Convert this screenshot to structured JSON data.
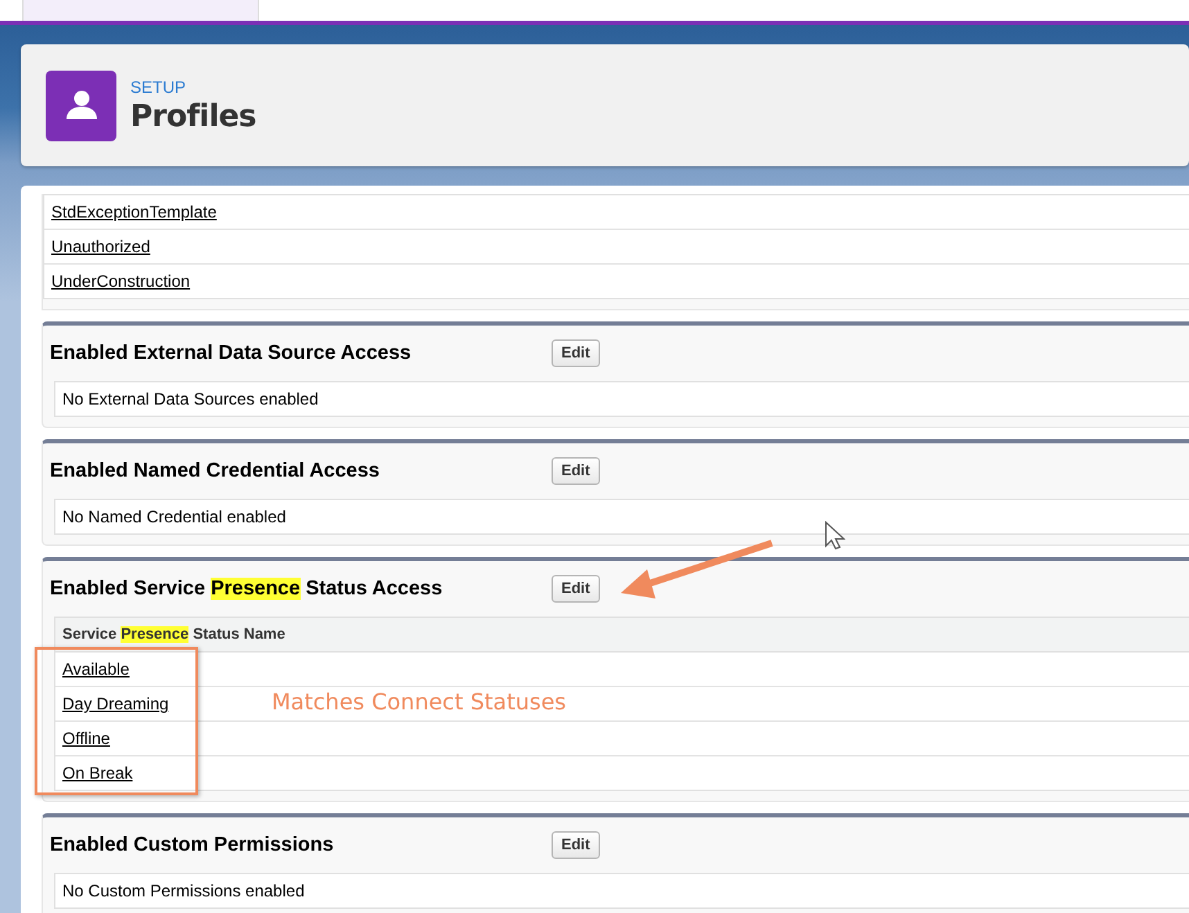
{
  "header": {
    "eyebrow": "SETUP",
    "title": "Profiles"
  },
  "top_table": {
    "rows": [
      "StdExceptionTemplate",
      "Unauthorized",
      "UnderConstruction"
    ]
  },
  "sections": [
    {
      "kind": "message",
      "title": [
        {
          "text": "Enabled External Data Source Access",
          "highlighted": false
        }
      ],
      "button": "Edit",
      "message": "No External Data Sources enabled"
    },
    {
      "kind": "message",
      "title": [
        {
          "text": "Enabled Named Credential Access",
          "highlighted": false
        }
      ],
      "button": "Edit",
      "message": "No Named Credential enabled"
    },
    {
      "kind": "table",
      "title": [
        {
          "text": "Enabled Service ",
          "highlighted": false
        },
        {
          "text": "Presence",
          "highlighted": true
        },
        {
          "text": " Status Access",
          "highlighted": false
        }
      ],
      "button": "Edit",
      "column": [
        {
          "text": "Service ",
          "highlighted": false
        },
        {
          "text": "Presence",
          "highlighted": true
        },
        {
          "text": " Status Name",
          "highlighted": false
        }
      ],
      "rows": [
        "Available",
        "Day Dreaming",
        "Offline",
        "On Break"
      ]
    },
    {
      "kind": "message",
      "title": [
        {
          "text": "Enabled Custom Permissions",
          "highlighted": false
        }
      ],
      "button": "Edit",
      "message": "No Custom Permissions enabled"
    }
  ],
  "annotation": {
    "text": "Matches Connect Statuses"
  }
}
